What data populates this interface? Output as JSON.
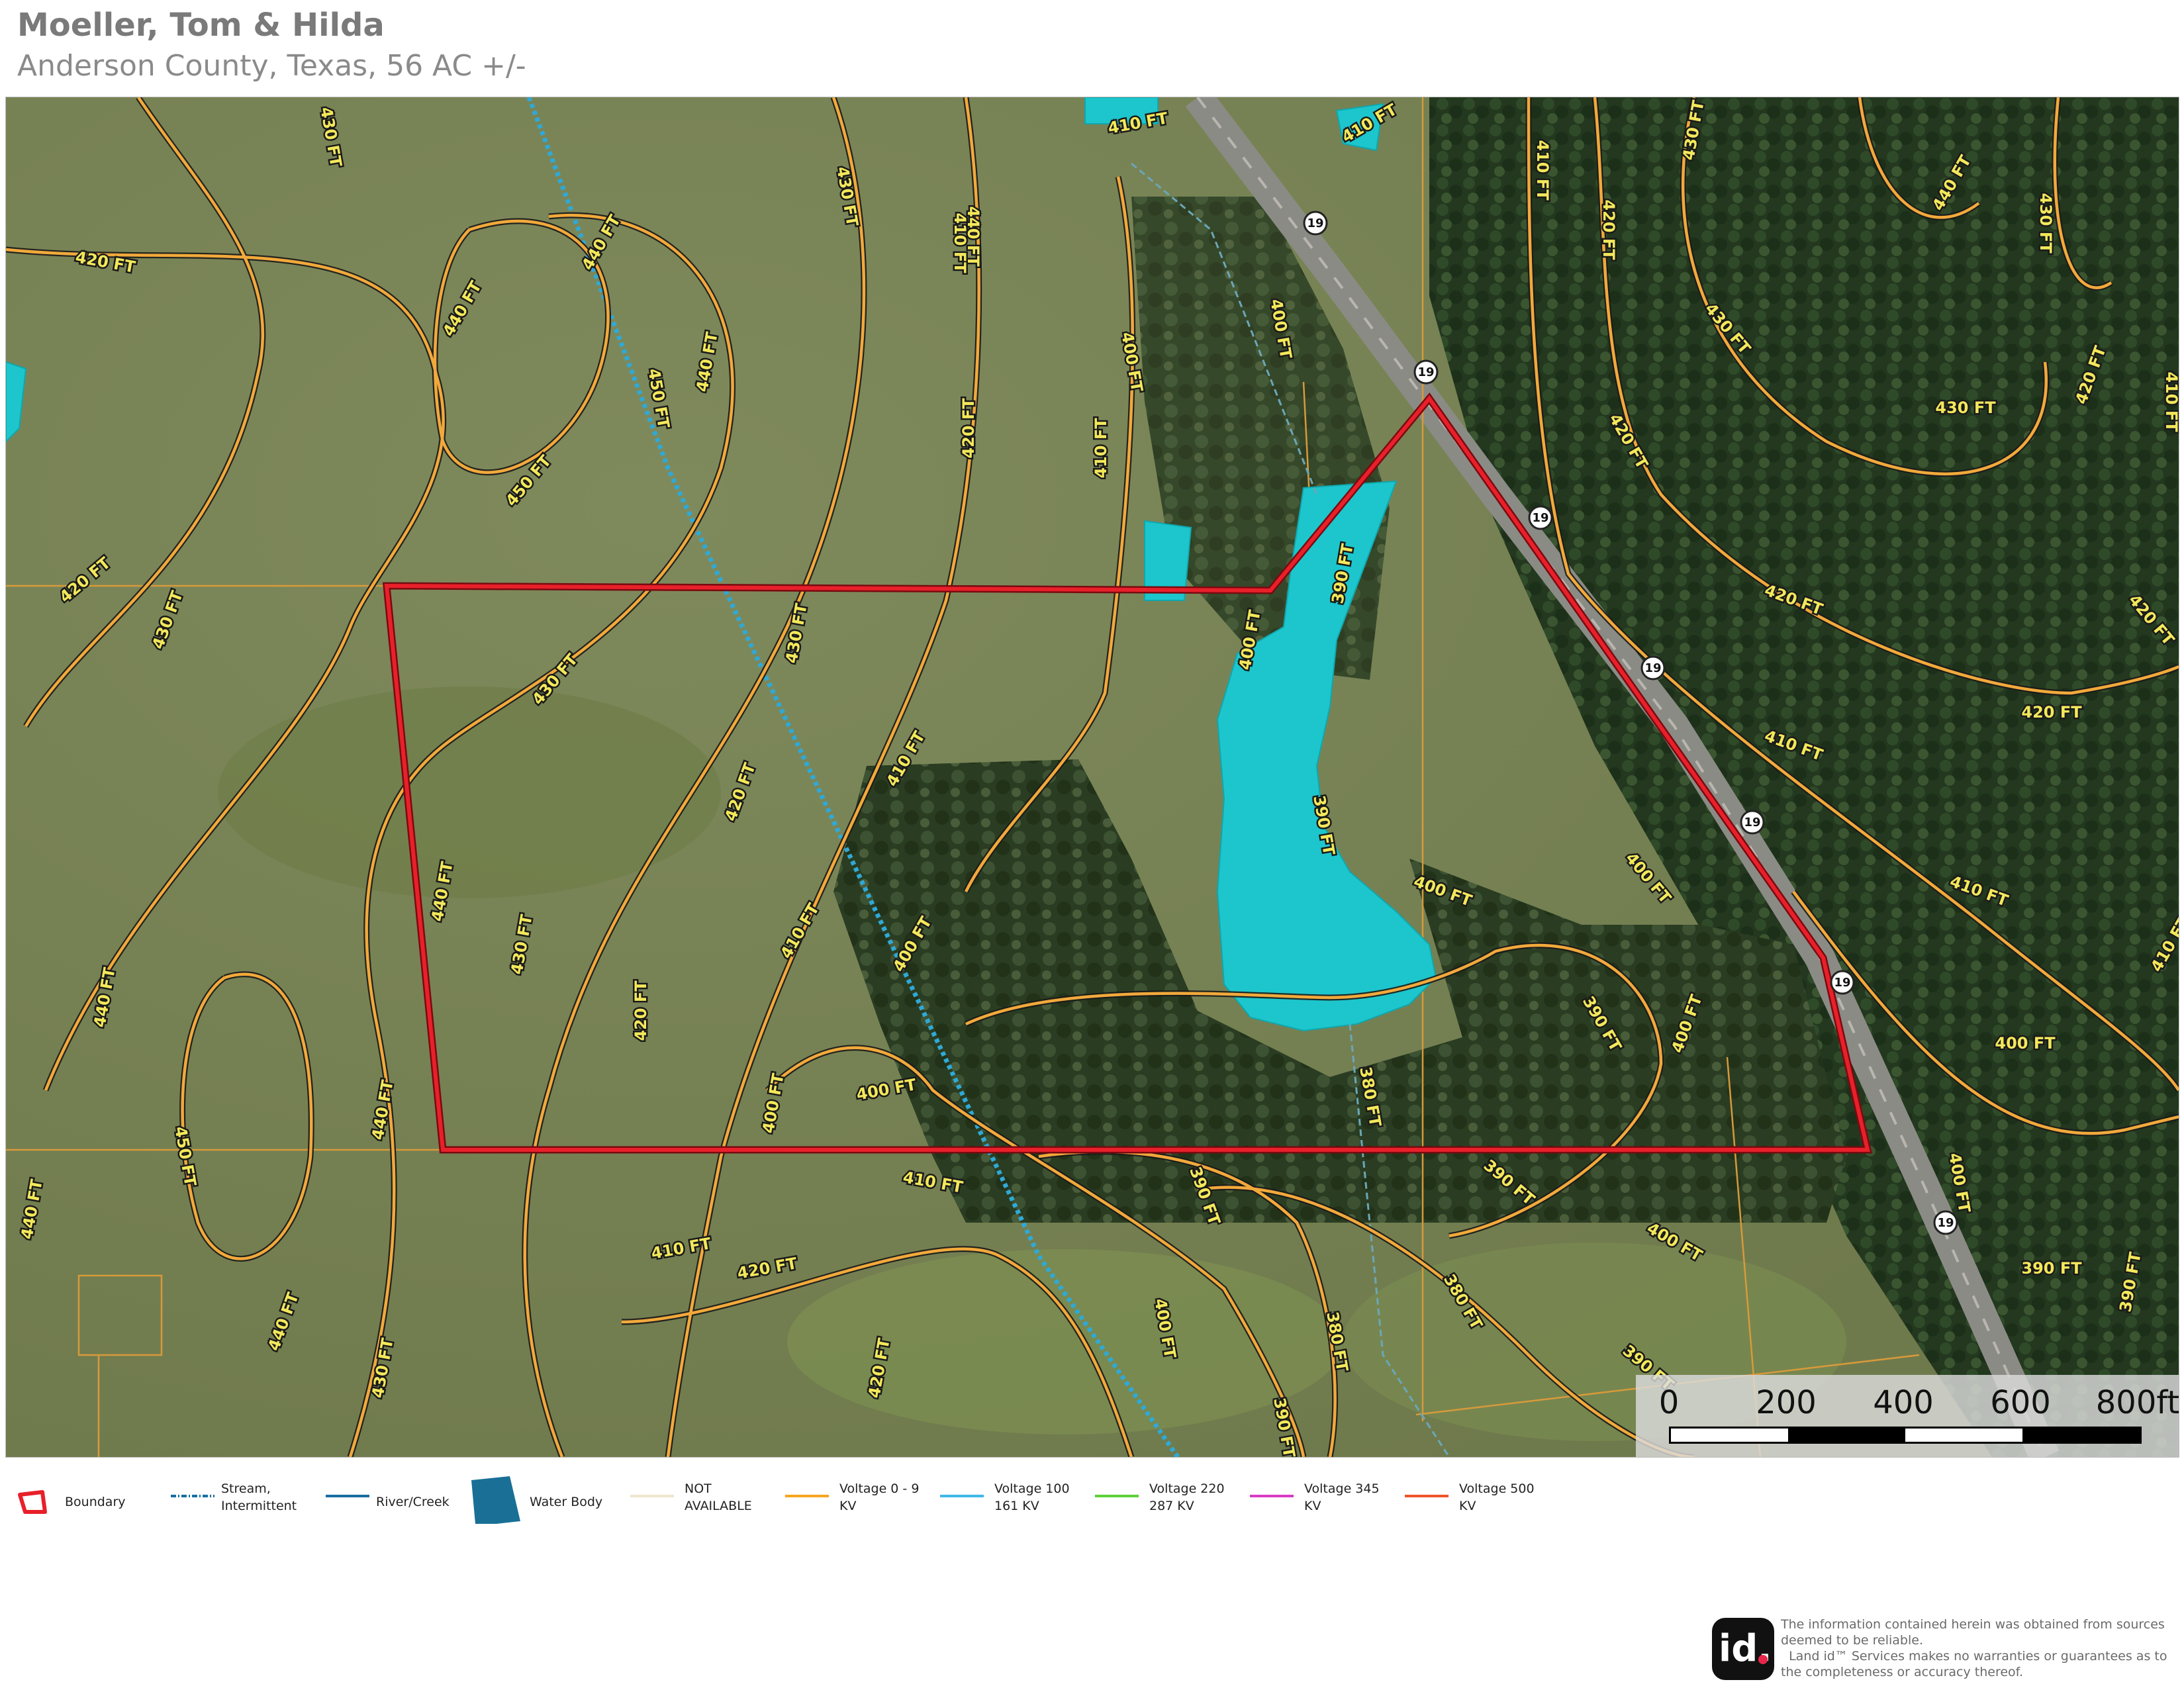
{
  "header": {
    "title": "Moeller, Tom & Hilda",
    "subtitle": "Anderson County, Texas, 56 AC +/-"
  },
  "map": {
    "contour_labels": [
      "400 FT",
      "410 FT",
      "420 FT",
      "430 FT",
      "440 FT",
      "450 FT",
      "390 FT",
      "380 FT"
    ],
    "highway_shield": "19",
    "colors": {
      "boundary": "#e8202a",
      "contour": "#f2a93b",
      "contour_label": "#f3e85a",
      "water": "#1cc6cc",
      "stream": "#2fa9d6",
      "parcel_line": "#e0a040"
    }
  },
  "scale": {
    "labels": [
      "0",
      "200",
      "400",
      "600",
      "800ft"
    ]
  },
  "legend": {
    "items": [
      {
        "label": "Boundary",
        "icon": "boundary-icon",
        "color": "#e8202a"
      },
      {
        "label": "Stream,\nIntermittent",
        "icon": "stream-intermittent-icon",
        "color": "#1a6fa0"
      },
      {
        "label": "River/Creek",
        "icon": "river-creek-icon",
        "color": "#1a6fa0"
      },
      {
        "label": "Water Body",
        "icon": "water-body-icon",
        "color": "#1a6f96"
      },
      {
        "label": "NOT\nAVAILABLE",
        "icon": "not-available-icon",
        "color": "#efe6cf"
      },
      {
        "label": "Voltage 0 - 9\nKV",
        "icon": "voltage-0-9-icon",
        "color": "#f5a623"
      },
      {
        "label": "Voltage 100\n161 KV",
        "icon": "voltage-100-161-icon",
        "color": "#3fb8e8"
      },
      {
        "label": "Voltage 220\n287 KV",
        "icon": "voltage-220-287-icon",
        "color": "#5fd13a"
      },
      {
        "label": "Voltage 345\nKV",
        "icon": "voltage-345-icon",
        "color": "#d93cc4"
      },
      {
        "label": "Voltage 500\nKV",
        "icon": "voltage-500-icon",
        "color": "#f0552a"
      }
    ]
  },
  "footer": {
    "logo_text": "id.",
    "disclaimer": "The information contained herein was obtained from sources deemed to be reliable.\n  Land id™ Services makes no warranties or guarantees as to the completeness or accuracy thereof."
  }
}
